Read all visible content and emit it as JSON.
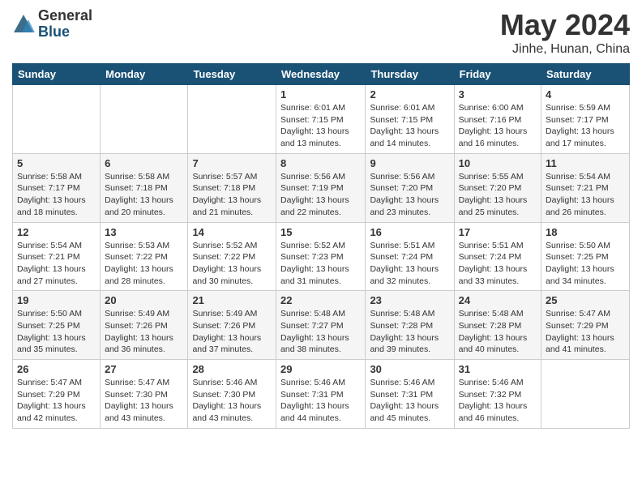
{
  "header": {
    "logo_general": "General",
    "logo_blue": "Blue",
    "title": "May 2024",
    "subtitle": "Jinhe, Hunan, China"
  },
  "days_of_week": [
    "Sunday",
    "Monday",
    "Tuesday",
    "Wednesday",
    "Thursday",
    "Friday",
    "Saturday"
  ],
  "weeks": [
    [
      {
        "num": "",
        "info": ""
      },
      {
        "num": "",
        "info": ""
      },
      {
        "num": "",
        "info": ""
      },
      {
        "num": "1",
        "info": "Sunrise: 6:01 AM\nSunset: 7:15 PM\nDaylight: 13 hours\nand 13 minutes."
      },
      {
        "num": "2",
        "info": "Sunrise: 6:01 AM\nSunset: 7:15 PM\nDaylight: 13 hours\nand 14 minutes."
      },
      {
        "num": "3",
        "info": "Sunrise: 6:00 AM\nSunset: 7:16 PM\nDaylight: 13 hours\nand 16 minutes."
      },
      {
        "num": "4",
        "info": "Sunrise: 5:59 AM\nSunset: 7:17 PM\nDaylight: 13 hours\nand 17 minutes."
      }
    ],
    [
      {
        "num": "5",
        "info": "Sunrise: 5:58 AM\nSunset: 7:17 PM\nDaylight: 13 hours\nand 18 minutes."
      },
      {
        "num": "6",
        "info": "Sunrise: 5:58 AM\nSunset: 7:18 PM\nDaylight: 13 hours\nand 20 minutes."
      },
      {
        "num": "7",
        "info": "Sunrise: 5:57 AM\nSunset: 7:18 PM\nDaylight: 13 hours\nand 21 minutes."
      },
      {
        "num": "8",
        "info": "Sunrise: 5:56 AM\nSunset: 7:19 PM\nDaylight: 13 hours\nand 22 minutes."
      },
      {
        "num": "9",
        "info": "Sunrise: 5:56 AM\nSunset: 7:20 PM\nDaylight: 13 hours\nand 23 minutes."
      },
      {
        "num": "10",
        "info": "Sunrise: 5:55 AM\nSunset: 7:20 PM\nDaylight: 13 hours\nand 25 minutes."
      },
      {
        "num": "11",
        "info": "Sunrise: 5:54 AM\nSunset: 7:21 PM\nDaylight: 13 hours\nand 26 minutes."
      }
    ],
    [
      {
        "num": "12",
        "info": "Sunrise: 5:54 AM\nSunset: 7:21 PM\nDaylight: 13 hours\nand 27 minutes."
      },
      {
        "num": "13",
        "info": "Sunrise: 5:53 AM\nSunset: 7:22 PM\nDaylight: 13 hours\nand 28 minutes."
      },
      {
        "num": "14",
        "info": "Sunrise: 5:52 AM\nSunset: 7:22 PM\nDaylight: 13 hours\nand 30 minutes."
      },
      {
        "num": "15",
        "info": "Sunrise: 5:52 AM\nSunset: 7:23 PM\nDaylight: 13 hours\nand 31 minutes."
      },
      {
        "num": "16",
        "info": "Sunrise: 5:51 AM\nSunset: 7:24 PM\nDaylight: 13 hours\nand 32 minutes."
      },
      {
        "num": "17",
        "info": "Sunrise: 5:51 AM\nSunset: 7:24 PM\nDaylight: 13 hours\nand 33 minutes."
      },
      {
        "num": "18",
        "info": "Sunrise: 5:50 AM\nSunset: 7:25 PM\nDaylight: 13 hours\nand 34 minutes."
      }
    ],
    [
      {
        "num": "19",
        "info": "Sunrise: 5:50 AM\nSunset: 7:25 PM\nDaylight: 13 hours\nand 35 minutes."
      },
      {
        "num": "20",
        "info": "Sunrise: 5:49 AM\nSunset: 7:26 PM\nDaylight: 13 hours\nand 36 minutes."
      },
      {
        "num": "21",
        "info": "Sunrise: 5:49 AM\nSunset: 7:26 PM\nDaylight: 13 hours\nand 37 minutes."
      },
      {
        "num": "22",
        "info": "Sunrise: 5:48 AM\nSunset: 7:27 PM\nDaylight: 13 hours\nand 38 minutes."
      },
      {
        "num": "23",
        "info": "Sunrise: 5:48 AM\nSunset: 7:28 PM\nDaylight: 13 hours\nand 39 minutes."
      },
      {
        "num": "24",
        "info": "Sunrise: 5:48 AM\nSunset: 7:28 PM\nDaylight: 13 hours\nand 40 minutes."
      },
      {
        "num": "25",
        "info": "Sunrise: 5:47 AM\nSunset: 7:29 PM\nDaylight: 13 hours\nand 41 minutes."
      }
    ],
    [
      {
        "num": "26",
        "info": "Sunrise: 5:47 AM\nSunset: 7:29 PM\nDaylight: 13 hours\nand 42 minutes."
      },
      {
        "num": "27",
        "info": "Sunrise: 5:47 AM\nSunset: 7:30 PM\nDaylight: 13 hours\nand 43 minutes."
      },
      {
        "num": "28",
        "info": "Sunrise: 5:46 AM\nSunset: 7:30 PM\nDaylight: 13 hours\nand 43 minutes."
      },
      {
        "num": "29",
        "info": "Sunrise: 5:46 AM\nSunset: 7:31 PM\nDaylight: 13 hours\nand 44 minutes."
      },
      {
        "num": "30",
        "info": "Sunrise: 5:46 AM\nSunset: 7:31 PM\nDaylight: 13 hours\nand 45 minutes."
      },
      {
        "num": "31",
        "info": "Sunrise: 5:46 AM\nSunset: 7:32 PM\nDaylight: 13 hours\nand 46 minutes."
      },
      {
        "num": "",
        "info": ""
      }
    ]
  ]
}
